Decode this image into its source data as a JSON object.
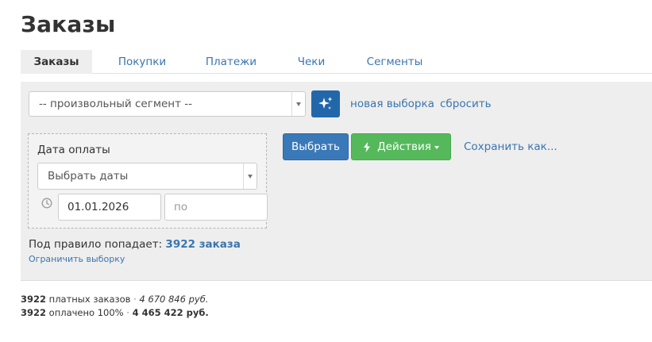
{
  "page": {
    "title": "Заказы"
  },
  "tabs": [
    {
      "label": "Заказы",
      "active": true
    },
    {
      "label": "Покупки"
    },
    {
      "label": "Платежи"
    },
    {
      "label": "Чеки"
    },
    {
      "label": "Сегменты"
    }
  ],
  "segment": {
    "selected": "-- произвольный сегмент --",
    "new_selection_link": "новая выборка",
    "reset_link": "сбросить"
  },
  "filter": {
    "label": "Дата оплаты",
    "range_select": "Выбрать даты",
    "date_from": "01.01.2026",
    "date_to_placeholder": "по"
  },
  "actions": {
    "select_button": "Выбрать",
    "actions_button": "Действия",
    "save_link": "Сохранить как..."
  },
  "rule": {
    "text": "Под правило попадает:",
    "count": "3922 заказа",
    "limit_link": "Ограничить выборку"
  },
  "stats": {
    "paid": {
      "count": "3922",
      "label": "платных заказов",
      "sum": "4 670 846 руб."
    },
    "paid_full": {
      "count": "3922",
      "label": "оплачено 100%",
      "sum": "4 465 422 руб."
    }
  },
  "colors": {
    "link": "#3a75ae",
    "primary_button": "#3a79b8",
    "success_button": "#55b95b",
    "magic_button": "#2367ab",
    "panel_bg": "#eeeeee"
  }
}
